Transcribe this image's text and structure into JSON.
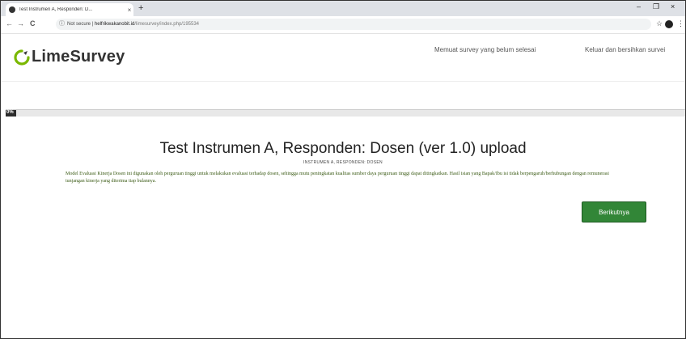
{
  "browser": {
    "tab_title": "Test Instrumen A, Responden: D...",
    "tab_close": "×",
    "new_tab": "+",
    "window_controls": [
      "–",
      "❐",
      "×"
    ],
    "nav": {
      "back": "←",
      "forward": "→",
      "reload": "C"
    },
    "url_security": "Not secure",
    "url_host": "helfrikwakanobit.id",
    "url_path": "/limesurvey/index.php/195534",
    "toolbar_icons": [
      "☆",
      "★"
    ]
  },
  "header": {
    "logo_text": "LimeSurvey",
    "link_resume": "Memuat survey yang belum selesai",
    "link_exit": "Keluar dan bersihkan survei"
  },
  "progress": {
    "label": "0%",
    "value_percent": 0
  },
  "survey": {
    "title": "Test Instrumen A, Responden: Dosen (ver 1.0) upload",
    "subtitle": "INSTRUMEN A, RESPONDEN: DOSEN",
    "description": "Model Evaluasi Kinerja Dosen ini digunakan oleh perguruan tinggi untuk melakukan evaluasi terhadap dosen, sehingga mutu peningkatan kualitas sumber daya perguruan tinggi dapat ditingkatkan. Hasil isian yang Bapak/Ibu isi tidak berpengaruh/berhubungan dengan remunerasi tunjangan kinerja yang diterima tiap bulannya.",
    "next_label": "Berikutnya"
  },
  "colors": {
    "accent_green": "#328637",
    "desc_text": "#3a5a14"
  }
}
